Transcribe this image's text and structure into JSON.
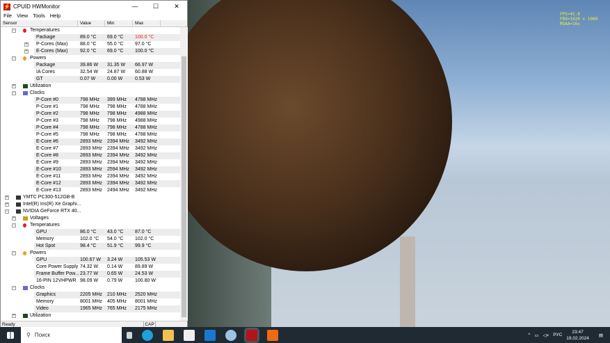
{
  "osd": {
    "fps": "FPS=41.8",
    "fro": "FRO=1920 x 1080",
    "msaa": "MSAA=16x"
  },
  "window": {
    "title": "CPUID HWMonitor",
    "minimize": "—",
    "maximize": "☐",
    "close": "✕"
  },
  "menu": [
    "File",
    "View",
    "Tools",
    "Help"
  ],
  "columns": [
    "Sensor",
    "Value",
    "Min",
    "Max"
  ],
  "rows": [
    {
      "l": 1,
      "t": "g",
      "icon": "thermometer",
      "name": "Temperatures"
    },
    {
      "l": 2,
      "name": "Package",
      "v": "89.0 °C",
      "min": "69.0 °C",
      "max": "100.0 °C",
      "alert": true
    },
    {
      "l": 2,
      "exp": true,
      "name": "P-Cores (Max)",
      "v": "88.0 °C",
      "min": "55.0 °C",
      "max": "97.0 °C"
    },
    {
      "l": 2,
      "exp": true,
      "name": "E-Cores (Max)",
      "v": "92.0 °C",
      "min": "69.0 °C",
      "max": "100.0 °C"
    },
    {
      "l": 1,
      "t": "g",
      "icon": "flame",
      "name": "Powers"
    },
    {
      "l": 2,
      "name": "Package",
      "v": "39.86 W",
      "min": "31.35 W",
      "max": "66.97 W"
    },
    {
      "l": 2,
      "name": "IA Cores",
      "v": "32.54 W",
      "min": "24.87 W",
      "max": "60.88 W"
    },
    {
      "l": 2,
      "name": "GT",
      "v": "0.07 W",
      "min": "0.00 W",
      "max": "0.53 W"
    },
    {
      "l": 1,
      "t": "g",
      "icon": "utilization",
      "name": "Utilization",
      "collapsed": true
    },
    {
      "l": 1,
      "t": "g",
      "icon": "clock",
      "name": "Clocks"
    },
    {
      "l": 2,
      "name": "P-Core #0",
      "v": "798 MHz",
      "min": "399 MHz",
      "max": "4788 MHz"
    },
    {
      "l": 2,
      "name": "P-Core #1",
      "v": "798 MHz",
      "min": "798 MHz",
      "max": "4788 MHz"
    },
    {
      "l": 2,
      "name": "P-Core #2",
      "v": "798 MHz",
      "min": "798 MHz",
      "max": "4988 MHz"
    },
    {
      "l": 2,
      "name": "P-Core #3",
      "v": "798 MHz",
      "min": "798 MHz",
      "max": "4988 MHz"
    },
    {
      "l": 2,
      "name": "P-Core #4",
      "v": "798 MHz",
      "min": "798 MHz",
      "max": "4788 MHz"
    },
    {
      "l": 2,
      "name": "P-Core #5",
      "v": "798 MHz",
      "min": "798 MHz",
      "max": "4788 MHz"
    },
    {
      "l": 2,
      "name": "E-Core #6",
      "v": "2893 MHz",
      "min": "2394 MHz",
      "max": "3492 MHz"
    },
    {
      "l": 2,
      "name": "E-Core #7",
      "v": "2893 MHz",
      "min": "2394 MHz",
      "max": "3492 MHz"
    },
    {
      "l": 2,
      "name": "E-Core #8",
      "v": "2893 MHz",
      "min": "2394 MHz",
      "max": "3492 MHz"
    },
    {
      "l": 2,
      "name": "E-Core #9",
      "v": "2893 MHz",
      "min": "2394 MHz",
      "max": "3492 MHz"
    },
    {
      "l": 2,
      "name": "E-Core #10",
      "v": "2893 MHz",
      "min": "2594 MHz",
      "max": "3492 MHz"
    },
    {
      "l": 2,
      "name": "E-Core #11",
      "v": "2893 MHz",
      "min": "2394 MHz",
      "max": "3492 MHz"
    },
    {
      "l": 2,
      "name": "E-Core #12",
      "v": "2893 MHz",
      "min": "2394 MHz",
      "max": "3492 MHz"
    },
    {
      "l": 2,
      "name": "E-Core #13",
      "v": "2893 MHz",
      "min": "2494 MHz",
      "max": "3492 MHz"
    },
    {
      "l": 0,
      "t": "g",
      "icon": "drive",
      "name": "YMTC PC300-512GB-B",
      "collapsed": true
    },
    {
      "l": 0,
      "t": "g",
      "icon": "gpu",
      "name": "Intel(R) Iris(R) Xe Graphi...",
      "collapsed": true
    },
    {
      "l": 0,
      "t": "g",
      "icon": "gpu",
      "name": "NVIDIA GeForce RTX 40..."
    },
    {
      "l": 1,
      "t": "g",
      "icon": "voltage",
      "name": "Voltages",
      "collapsed": true
    },
    {
      "l": 1,
      "t": "g",
      "icon": "thermometer",
      "name": "Temperatures"
    },
    {
      "l": 2,
      "name": "GPU",
      "v": "86.0 °C",
      "min": "43.0 °C",
      "max": "87.0 °C"
    },
    {
      "l": 2,
      "name": "Memory",
      "v": "102.0 °C",
      "min": "54.0 °C",
      "max": "102.0 °C"
    },
    {
      "l": 2,
      "name": "Hot Spot",
      "v": "98.4 °C",
      "min": "51.9 °C",
      "max": "99.9 °C"
    },
    {
      "l": 1,
      "t": "g",
      "icon": "flame",
      "name": "Powers"
    },
    {
      "l": 2,
      "name": "GPU",
      "v": "100.67 W",
      "min": "3.24 W",
      "max": "105.53 W"
    },
    {
      "l": 2,
      "name": "Core Power Supply",
      "v": "74.32 W",
      "min": "0.14 W",
      "max": "89.89 W"
    },
    {
      "l": 2,
      "name": "Frame Buffer Pow...",
      "v": "23.77 W",
      "min": "0.65 W",
      "max": "24.53 W"
    },
    {
      "l": 2,
      "name": "16-PIN 12VHPWR",
      "v": "98.09 W",
      "min": "0.79 W",
      "max": "100.80 W"
    },
    {
      "l": 1,
      "t": "g",
      "icon": "clock",
      "name": "Clocks"
    },
    {
      "l": 2,
      "name": "Graphics",
      "v": "2205 MHz",
      "min": "210 MHz",
      "max": "2520 MHz"
    },
    {
      "l": 2,
      "name": "Memory",
      "v": "8001 MHz",
      "min": "405 MHz",
      "max": "8001 MHz"
    },
    {
      "l": 2,
      "name": "Video",
      "v": "1965 MHz",
      "min": "765 MHz",
      "max": "2175 MHz"
    },
    {
      "l": 1,
      "t": "g",
      "icon": "utilization",
      "name": "Utilization",
      "collapsed": true
    }
  ],
  "status": {
    "text": "Ready",
    "cap": "CAP"
  },
  "taskbar": {
    "search": "Поиск",
    "lang": "РУС",
    "time": "23:47",
    "date": "19.02.2024"
  },
  "colors": {
    "alert": "#e02020",
    "taskbar": "#1f2a33"
  }
}
